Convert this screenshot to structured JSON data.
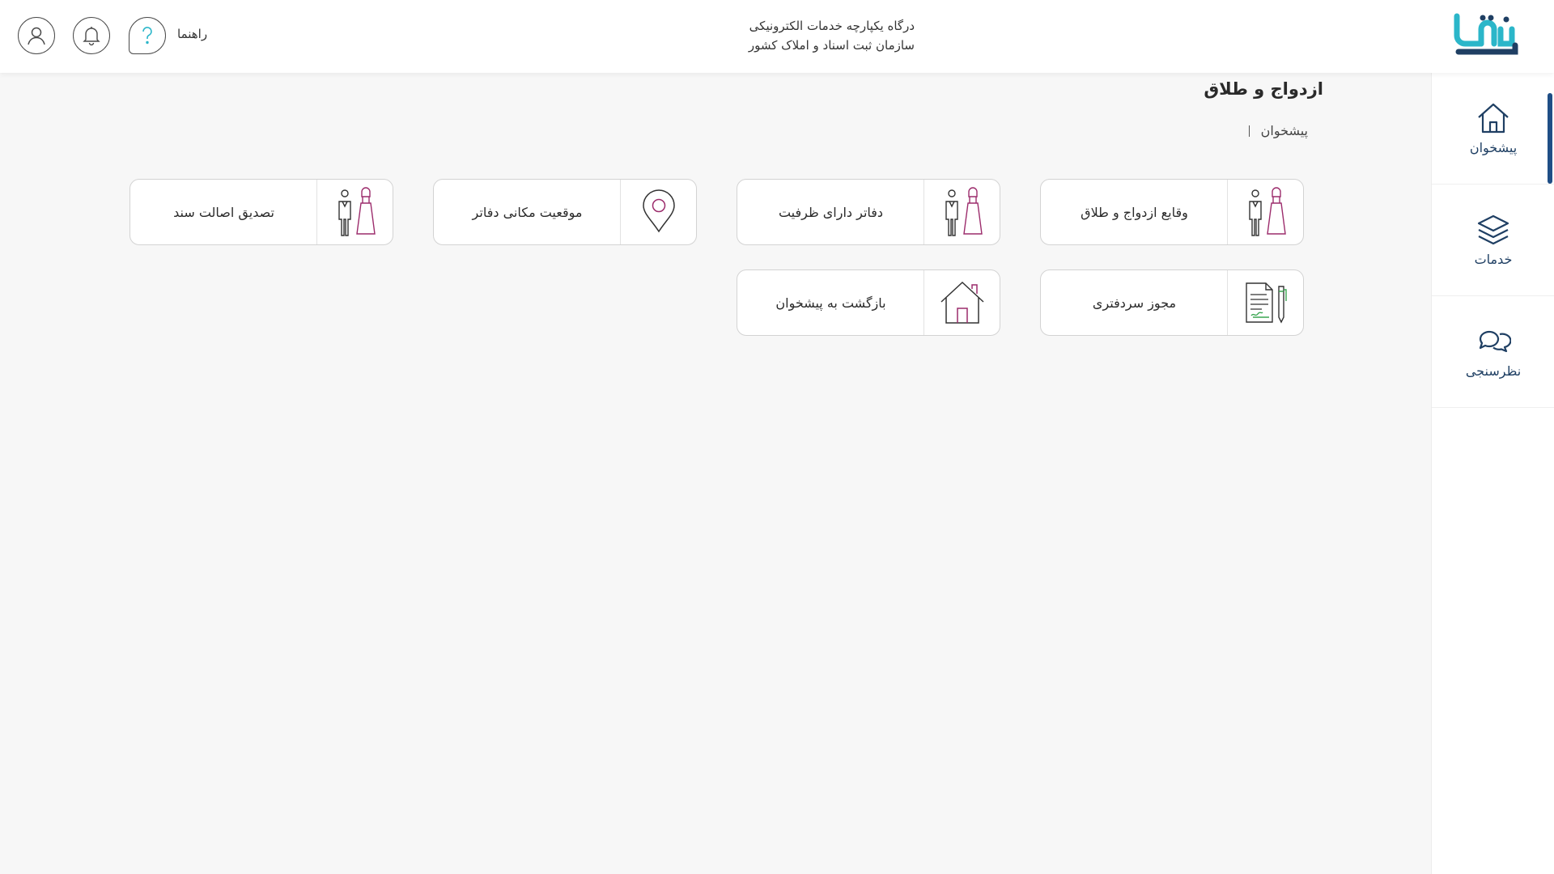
{
  "header": {
    "title_line1": "درگاه یکپارچه خدمات الکترونیکی",
    "title_line2": "سازمان ثبت اسناد و املاک کشور",
    "help_label": "راهنما"
  },
  "sidebar": {
    "items": [
      {
        "label": "پیشخوان",
        "icon": "home-icon",
        "active": true
      },
      {
        "label": "خدمات",
        "icon": "layers-icon",
        "active": false
      },
      {
        "label": "نظرسنجی",
        "icon": "chat-icon",
        "active": false
      }
    ]
  },
  "page": {
    "title": "ازدواج و طلاق",
    "breadcrumb": "پیشخوان"
  },
  "tiles": [
    {
      "label": "وقایع ازدواج و طلاق",
      "icon": "couple-icon"
    },
    {
      "label": "دفاتر دارای ظرفیت",
      "icon": "couple-icon"
    },
    {
      "label": "موقعیت مکانی دفاتر",
      "icon": "location-pin-icon"
    },
    {
      "label": "تصدیق اصالت سند",
      "icon": "couple-icon"
    },
    {
      "label": "مجوز سردفتری",
      "icon": "document-pen-icon"
    },
    {
      "label": "بازگشت به پیشخوان",
      "icon": "house-icon"
    }
  ],
  "colors": {
    "brand_teal": "#2bb6c9",
    "brand_navy": "#1f3f63",
    "accent_magenta": "#9c2c6c",
    "accent_green": "#3aa651"
  }
}
